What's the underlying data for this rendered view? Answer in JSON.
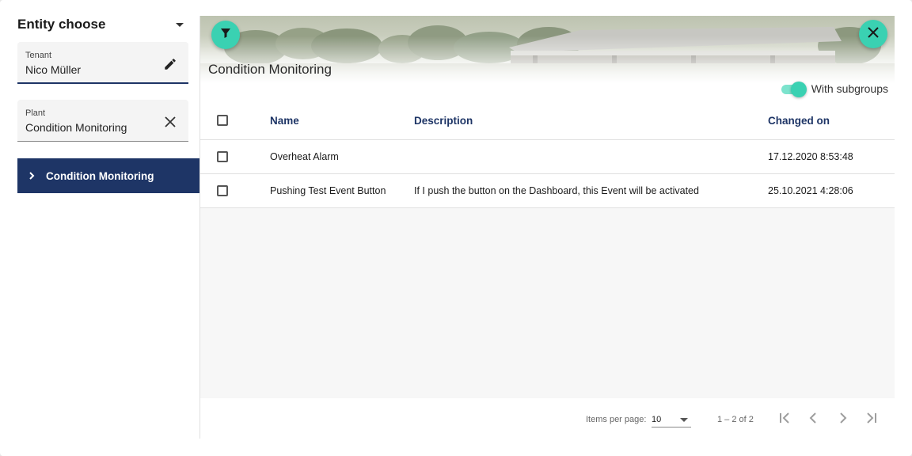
{
  "sidebar": {
    "title": "Entity choose",
    "tenant": {
      "label": "Tenant",
      "value": "Nico Müller"
    },
    "plant": {
      "label": "Plant",
      "value": "Condition Monitoring"
    },
    "tree_item": {
      "label": "Condition Monitoring"
    }
  },
  "main": {
    "title": "Condition Monitoring",
    "subgroups_label": "With subgroups",
    "subgroups_on": true,
    "columns": {
      "name": "Name",
      "description": "Description",
      "changed_on": "Changed on"
    },
    "rows": [
      {
        "name": "Overheat Alarm",
        "description": "",
        "changed_on": "17.12.2020 8:53:48"
      },
      {
        "name": "Pushing Test Event Button",
        "description": "If I push the button on the Dashboard, this Event will be activated",
        "changed_on": "25.10.2021 4:28:06"
      }
    ]
  },
  "paginator": {
    "items_per_page_label": "Items per page:",
    "items_per_page_value": "10",
    "range_label": "1 – 2 of 2"
  },
  "colors": {
    "accent": "#3ad1b2",
    "navy": "#1e3566"
  },
  "icons": {
    "filter": "filter-icon",
    "close": "close-icon",
    "edit": "pencil-icon",
    "clear": "clear-icon",
    "chevron": "chevron-right-icon"
  }
}
